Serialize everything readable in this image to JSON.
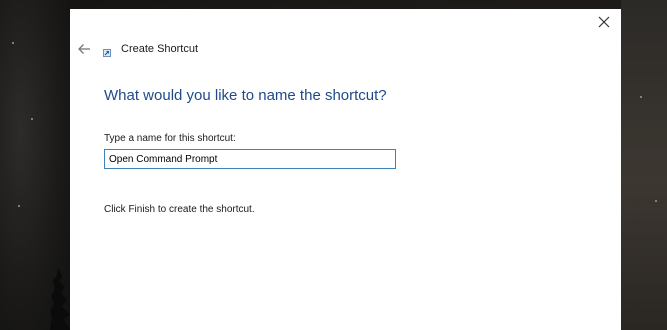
{
  "dialog": {
    "title": "Create Shortcut",
    "heading": "What would you like to name the shortcut?",
    "name_label": "Type a name for this shortcut:",
    "name_value": "Open Command Prompt",
    "hint_text": "Click Finish to create the shortcut.",
    "close_icon": "close-icon",
    "back_icon": "back-arrow-icon",
    "app_icon": "shortcut-wizard-icon"
  },
  "colors": {
    "heading": "#1e4a8a",
    "input_border": "#3c83b8",
    "dialog_background": "#ffffff"
  }
}
